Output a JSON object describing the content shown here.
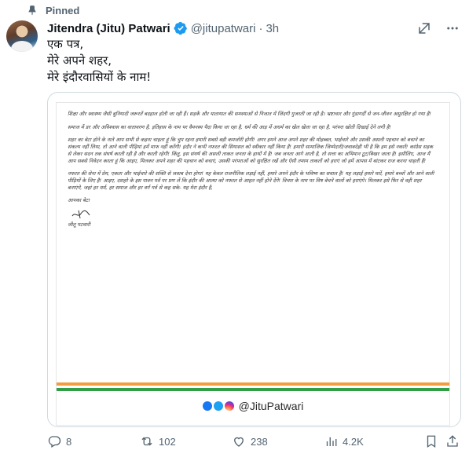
{
  "pinned": {
    "label": "Pinned",
    "icon": "pin-icon"
  },
  "author": {
    "display_name": "Jitendra (Jitu) Patwari",
    "handle": "@jitupatwari",
    "separator": "·",
    "time": "3h",
    "verified": true,
    "verified_color": "#1d9bf0"
  },
  "tweet": {
    "lines": [
      "एक पत्र,",
      "मेरे अपने शहर,",
      "मेरे इंदौरवासियों के नाम!"
    ]
  },
  "letter": {
    "paragraphs": [
      "शिक्षा और स्वास्थ्य जैसी बुनियादी जरूरतें बदहाल होती जा रही हैं। सड़कें और यातायात की समस्याओं से निजात में जिंदगी गुजरती जा रही है। भ्रष्टाचार और गुंडागर्दी से जन-जीवन असुरक्षित हो गया है!",
      "समाज में डर और अविश्वास का वातावरण है, इतिहास के नाम पर वैमनस्य पैदा किया जा रहा है, धर्म की आड़ में अधर्म का खेल खेला जा रहा है, परंपरा खोती दिखाई देने लगी है!",
      "शहर का बेटा होने के नाते आप सभी से कहना चाहता हूं कि चुप रहना हमारी सबसे बड़ी कमजोरी होगी! अगर हमने आज अपने शहर की मोहब्बत, भाईचारे और उसकी असली पहचान को बचाने का संकल्प नहीं लिया, तो आने वाली पीढ़ियां हमें माफ नहीं करेंगी! इंदौर ने कभी नफरत की सियासत को स्वीकार नहीं किया है! हमारी सामाजिक जिम्मेदारी/जवाबदेही भी है कि हम इसे नकारें! कांग्रेस सड़क से लेकर सदन तक संघर्ष करती रही है और करती रहेगी! किंतु, इस संघर्ष की असली ताकत जनता के हाथों में है! जब जनता आगे आती है, तो सत्ता का अभिमान टूट/बिखर जाता है! इसीलिए, आज मैं आप सबसे निवेदन करता हूं कि आइए, मिलकर अपने शहर की पहचान को बचाएं, उसकी परंपराओं को सुरक्षित रखें और ऐसी तमाम ताकतों को हराएं जो हमें आपस में बांटकर राज करना चाहती हैं!",
      "नफरत की सेना में प्रेम, एकता और भाईचारे की शक्ति से जवाब देना होगा! यह केवल राजनीतिक लड़ाई नहीं, हमारे अपने इंदौर के भविष्य का सवाल है! यह लड़ाई हमारे घरों, हमारे बच्चों और आने वाली पीढ़ियों के लिए है! आइए, दशहरे के इस पावन पर्व पर प्रण लें कि इंदौर की आत्मा को नफरत से आहत नहीं होने देंगे! विचार के नाम पर विष बेचने वालों को हराएंगे। मिलकर इसे फिर से वही शहर बनाएंगे, जहां हर धर्म, हर समाज और हर वर्ग गर्व से कह सके- यह मेरा इंदौर है,"
    ],
    "closing": "आपका बेटा",
    "signature_name": "जीतू पटवारी",
    "social_handle": "@JituPatwari",
    "social_icons": [
      "facebook-icon",
      "twitter-icon",
      "instagram-icon"
    ],
    "tricolor": [
      "#f39c3d",
      "#ffffff",
      "#2f9e44"
    ]
  },
  "actions": {
    "reply_count": "8",
    "repost_count": "102",
    "like_count": "238",
    "views_count": "4.2K"
  }
}
